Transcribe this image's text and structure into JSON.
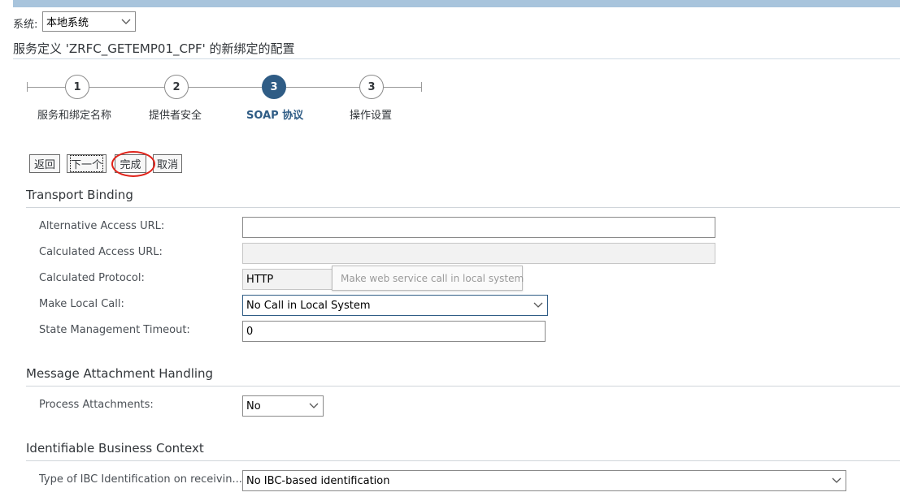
{
  "header": {
    "system_label": "系统:",
    "system_value": "本地系统",
    "title": "服务定义 'ZRFC_GETEMP01_CPF' 的新绑定的配置"
  },
  "wizard": {
    "steps": [
      {
        "number": "1",
        "label": "服务和绑定名称"
      },
      {
        "number": "2",
        "label": "提供者安全"
      },
      {
        "number": "3",
        "label": "SOAP 协议"
      },
      {
        "number": "3",
        "label": "操作设置"
      }
    ],
    "active_step": "SOAP 协议"
  },
  "buttons": {
    "back": "返回",
    "next": "下一个",
    "finish": "完成",
    "cancel": "取消"
  },
  "transport_binding": {
    "title": "Transport Binding",
    "alt_access_url_label": "Alternative Access URL:",
    "alt_access_url_value": "",
    "calc_access_url_label": "Calculated Access URL:",
    "calc_access_url_value": "",
    "calc_protocol_label": "Calculated Protocol:",
    "calc_protocol_value": "HTTP",
    "tooltip": "Make web service call in local system",
    "local_call_label": "Make Local Call:",
    "local_call_value": "No Call in Local System",
    "state_timeout_label": "State Management Timeout:",
    "state_timeout_value": "0"
  },
  "message_attachment": {
    "title": "Message Attachment Handling",
    "process_label": "Process Attachments:",
    "process_value": "No"
  },
  "ibc": {
    "title": "Identifiable Business Context",
    "type_label": "Type of IBC Identification on receivin... :",
    "type_value": "No IBC-based identification"
  },
  "colors": {
    "active_step": "#2f5c85",
    "highlight": "#e0231a",
    "top_bar": "#a8c4dc"
  }
}
